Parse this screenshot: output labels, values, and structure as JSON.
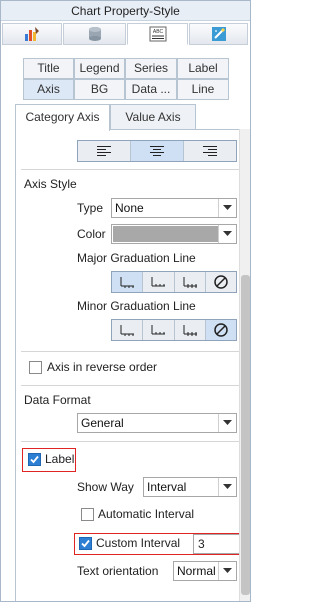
{
  "window": {
    "title": "Chart Property-Style"
  },
  "toolbar": {
    "icons": [
      "chart-type-icon",
      "database-icon",
      "abc-style-icon",
      "magic-icon"
    ],
    "active_index": 2
  },
  "subtabs": {
    "row1": [
      "Title",
      "Legend",
      "Series",
      "Label"
    ],
    "row2": [
      "Axis",
      "BG",
      "Data ...",
      "Line"
    ],
    "active": "Axis"
  },
  "page_tabs": {
    "category": "Category Axis",
    "value": "Value Axis",
    "active": "Category Axis"
  },
  "axis_style": {
    "heading": "Axis Style",
    "type_label": "Type",
    "type_value": "None",
    "color_label": "Color",
    "color_value": "#a8a8a8",
    "major_label": "Major Graduation Line",
    "minor_label": "Minor Graduation Line",
    "reverse_label": "Axis in reverse order",
    "reverse_checked": false
  },
  "data_format": {
    "heading": "Data Format",
    "value": "General"
  },
  "label": {
    "checkbox_label": "Label",
    "checked": true,
    "show_way_label": "Show Way",
    "show_way_value": "Interval",
    "auto_interval_label": "Automatic Interval",
    "auto_interval_checked": false,
    "custom_interval_label": "Custom Interval",
    "custom_interval_checked": true,
    "custom_interval_value": "3",
    "orientation_label": "Text orientation",
    "orientation_value": "Normal"
  },
  "colors": {
    "accent": "#2d7fd3",
    "highlight": "#e02424",
    "tab_active": "#dce8f6"
  }
}
